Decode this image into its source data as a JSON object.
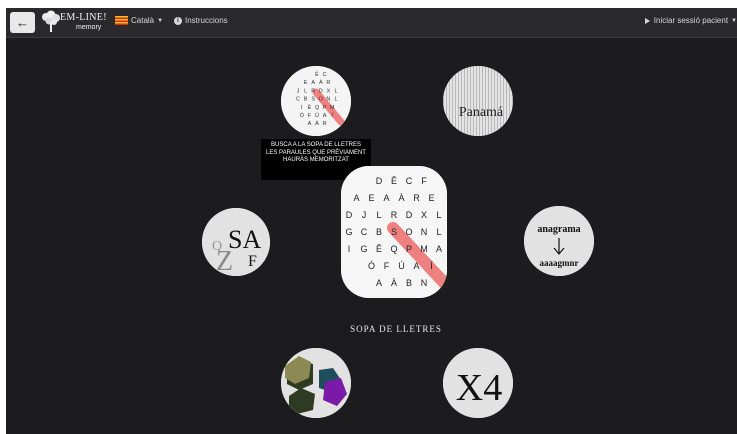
{
  "navbar": {
    "back_icon": "arrow-left-icon",
    "logo": {
      "title": "EM-LINE!",
      "subtitle": "memory"
    },
    "language": {
      "label": "Català",
      "flag_icon": "catalan-flag-icon"
    },
    "instructions": {
      "label": "Instruccions",
      "icon": "info-circle-icon"
    },
    "start_session": {
      "label": "Iniciar sessió pacient",
      "icon": "play-icon"
    }
  },
  "tooltip": {
    "text": "BUSCA A LA SOPA DE LLETRES LES PARAULES QUE PRÈVIAMENT HAURÀS MEMORITZAT"
  },
  "games": {
    "word_search_small": {
      "grid": [
        [
          "",
          "Ê",
          "C"
        ],
        [
          "E",
          "A",
          "À",
          "R"
        ],
        [
          "J",
          "L",
          "R",
          "D",
          "X",
          "L"
        ],
        [
          "C",
          "B",
          "S",
          "O",
          "N",
          "L"
        ],
        [
          "I",
          "Ê",
          "Q",
          "P",
          "M"
        ],
        [
          "Ó",
          "F",
          "Ú",
          "A",
          "Í"
        ],
        [
          "A",
          "À",
          "R"
        ]
      ]
    },
    "panama": {
      "text": "Panamá"
    },
    "letters": {
      "big": "SA",
      "small": "F",
      "faded_1": "Q",
      "faded_2": "Z"
    },
    "anagram": {
      "top": "anagrama",
      "bottom": "aaaagmnr"
    },
    "x4": {
      "text": "X4"
    },
    "current_game": {
      "label": "SOPA DE LLETRES",
      "grid": [
        [
          "",
          "D",
          "Ê",
          "C",
          "F"
        ],
        [
          "A",
          "E",
          "A",
          "À",
          "R",
          "E"
        ],
        [
          "D",
          "J",
          "L",
          "R",
          "D",
          "X",
          "L"
        ],
        [
          "G",
          "C",
          "B",
          "S",
          "O",
          "N",
          "L"
        ],
        [
          "I",
          "G",
          "Ê",
          "Q",
          "P",
          "M",
          "A"
        ],
        [
          "",
          "Ó",
          "F",
          "Ú",
          "A",
          "Í"
        ],
        [
          "",
          "A",
          "À",
          "B",
          "N"
        ]
      ]
    }
  },
  "colors": {
    "background": "#1c1c1e",
    "navbar": "#2a2a2c",
    "highlight": "#ee6b6b"
  }
}
